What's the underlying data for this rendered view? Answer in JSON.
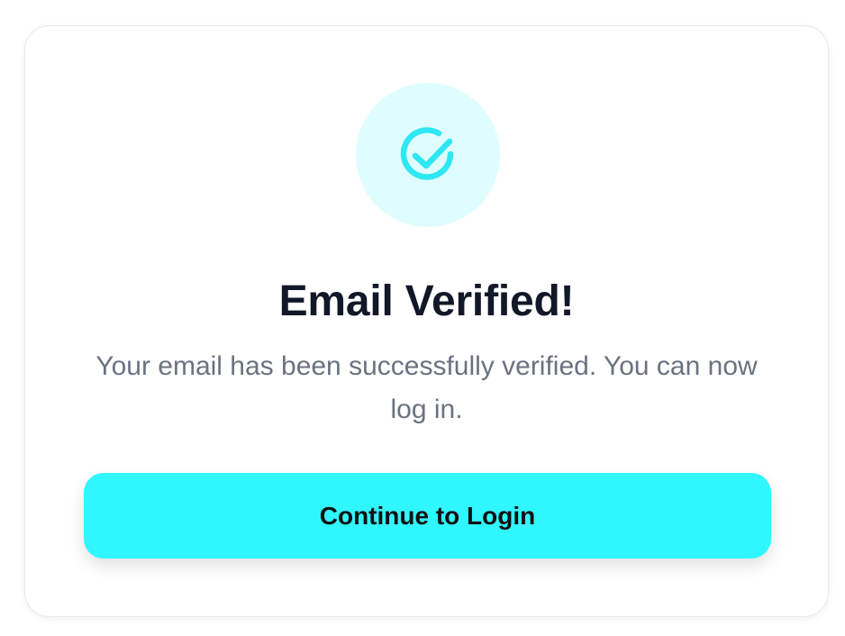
{
  "card": {
    "icon": "check-circle-icon",
    "title": "Email Verified!",
    "message": "Your email has been successfully verified. You can now log in.",
    "button_label": "Continue to Login"
  },
  "colors": {
    "accent": "#2ff6ff",
    "icon_bg": "#dffdff",
    "title": "#111827",
    "message": "#6b7280"
  }
}
